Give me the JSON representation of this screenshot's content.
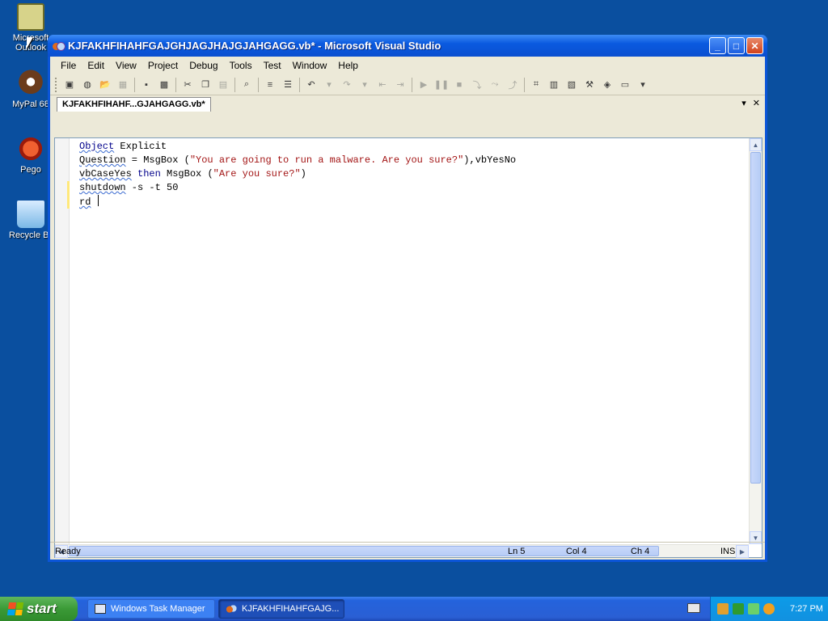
{
  "desktop": {
    "icons": [
      {
        "label": "Microsoft Outlook",
        "icon": "outlook-icon"
      },
      {
        "label": "MyPal 68",
        "icon": "mypal-icon"
      },
      {
        "label": "Pego",
        "icon": "pego-icon"
      },
      {
        "label": "Recycle Bin",
        "icon": "recycle-bin-icon"
      }
    ]
  },
  "window": {
    "title": "KJFAKHFIHAHFGAJGHJAGJHAJGJAHGAGG.vb* - Microsoft Visual Studio",
    "minimize": "_",
    "maximize": "□",
    "close": "✕"
  },
  "menu": {
    "items": [
      "File",
      "Edit",
      "View",
      "Project",
      "Debug",
      "Tools",
      "Test",
      "Window",
      "Help"
    ]
  },
  "tab": {
    "label": "KJFAKHFIHAHF...GJAHGAGG.vb*",
    "dropdown": "▾",
    "close": "✕"
  },
  "code": {
    "l1a": "Object",
    "l1b": " Explicit",
    "l2a": "Question",
    "l2b": " = MsgBox (",
    "l2c": "\"You are going to run a malware. Are you sure?\"",
    "l2d": "),vbYesNo",
    "l3a": "vbCaseYes",
    "l3b": " then",
    "l3c": " MsgBox (",
    "l3d": "\"Are you sure?\"",
    "l3e": ")",
    "l4a": "shutdown",
    "l4b": " -s -t 50",
    "l5a": "rd",
    "l5b": " "
  },
  "status": {
    "text": "Ready",
    "line": "Ln 5",
    "col": "Col 4",
    "ch": "Ch 4",
    "mode": "INS"
  },
  "taskbar": {
    "start": "start",
    "tasks": [
      {
        "label": "Windows Task Manager"
      },
      {
        "label": "KJFAKHFIHAHFGAJG..."
      }
    ],
    "clock": "7:27 PM"
  }
}
